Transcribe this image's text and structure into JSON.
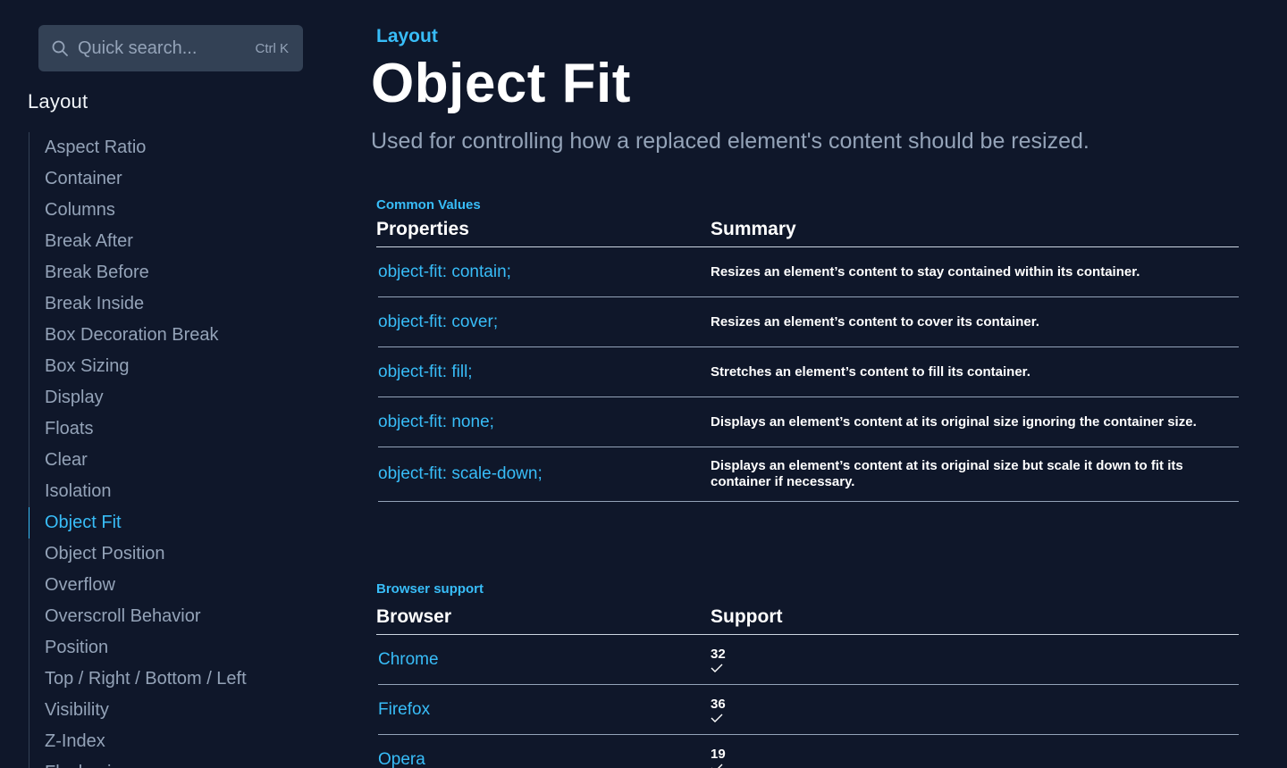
{
  "search": {
    "placeholder": "Quick search...",
    "shortcut": "Ctrl K",
    "icon": "search-icon"
  },
  "sidebar": {
    "heading": "Layout",
    "items": [
      {
        "label": "Aspect Ratio"
      },
      {
        "label": "Container"
      },
      {
        "label": "Columns"
      },
      {
        "label": "Break After"
      },
      {
        "label": "Break Before"
      },
      {
        "label": "Break Inside"
      },
      {
        "label": "Box Decoration Break"
      },
      {
        "label": "Box Sizing"
      },
      {
        "label": "Display"
      },
      {
        "label": "Floats"
      },
      {
        "label": "Clear"
      },
      {
        "label": "Isolation"
      },
      {
        "label": "Object Fit",
        "active": true
      },
      {
        "label": "Object Position"
      },
      {
        "label": "Overflow"
      },
      {
        "label": "Overscroll Behavior"
      },
      {
        "label": "Position"
      },
      {
        "label": "Top / Right / Bottom / Left"
      },
      {
        "label": "Visibility"
      },
      {
        "label": "Z-Index"
      },
      {
        "label": "Flexbasis"
      }
    ]
  },
  "page": {
    "category": "Layout",
    "title": "Object Fit",
    "description": "Used for controlling how a replaced element's content should be resized."
  },
  "values_table": {
    "section_label": "Common Values",
    "headers": [
      "Properties",
      "Summary"
    ],
    "rows": [
      {
        "property": "object-fit: contain;",
        "summary": "Resizes an element’s content to stay contained within its container."
      },
      {
        "property": "object-fit: cover;",
        "summary": "Resizes an element’s content to cover its container."
      },
      {
        "property": "object-fit: fill;",
        "summary": "Stretches an element’s content to fill its container."
      },
      {
        "property": "object-fit: none;",
        "summary": "Displays an element’s content at its original size ignoring the container size."
      },
      {
        "property": "object-fit: scale-down;",
        "summary": "Displays an element’s content at its original size but scale it down to fit its container if necessary."
      }
    ]
  },
  "browser_table": {
    "section_label": "Browser support",
    "headers": [
      "Browser",
      "Support"
    ],
    "rows": [
      {
        "browser": "Chrome",
        "version": "32",
        "supported": true
      },
      {
        "browser": "Firefox",
        "version": "36",
        "supported": true
      },
      {
        "browser": "Opera",
        "version": "19",
        "supported": true
      }
    ]
  },
  "colors": {
    "background": "#0f172a",
    "accent": "#38bdf8",
    "muted": "#94a3b8",
    "search_bg": "#334155"
  }
}
